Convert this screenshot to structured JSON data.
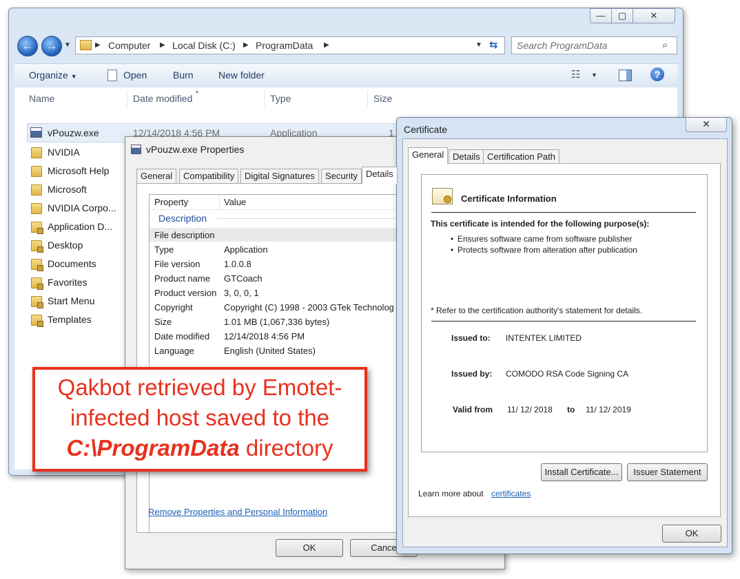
{
  "explorer": {
    "breadcrumb": [
      "Computer",
      "Local Disk (C:)",
      "ProgramData"
    ],
    "search_placeholder": "Search ProgramData",
    "toolbar": {
      "organize": "Organize",
      "open": "Open",
      "burn": "Burn",
      "new_folder": "New folder"
    },
    "columns": {
      "name": "Name",
      "date_modified": "Date modified",
      "type": "Type",
      "size": "Size"
    },
    "selected_file": {
      "name": "vPouzw.exe",
      "date_modified": "12/14/2018 4:56 PM",
      "type": "Application",
      "size": "1"
    },
    "items": [
      "NVIDIA",
      "Microsoft Help",
      "Microsoft",
      "NVIDIA Corpo...",
      "Application D...",
      "Desktop",
      "Documents",
      "Favorites",
      "Start Menu",
      "Templates"
    ]
  },
  "properties": {
    "title": "vPouzw.exe Properties",
    "tabs": [
      "General",
      "Compatibility",
      "Digital Signatures",
      "Security",
      "Details"
    ],
    "header": {
      "property": "Property",
      "value": "Value"
    },
    "section": "Description",
    "rows": [
      {
        "k": "File description",
        "v": ""
      },
      {
        "k": "Type",
        "v": "Application"
      },
      {
        "k": "File version",
        "v": "1.0.0.8"
      },
      {
        "k": "Product name",
        "v": "GTCoach"
      },
      {
        "k": "Product version",
        "v": "3, 0, 0, 1"
      },
      {
        "k": "Copyright",
        "v": "Copyright (C) 1998 - 2003 GTek Technolog"
      },
      {
        "k": "Size",
        "v": "1.01 MB (1,067,336 bytes)"
      },
      {
        "k": "Date modified",
        "v": "12/14/2018 4:56 PM"
      },
      {
        "k": "Language",
        "v": "English (United States)"
      }
    ],
    "remove_link": "Remove Properties and Personal Information",
    "ok": "OK",
    "cancel": "Cance"
  },
  "certificate": {
    "title": "Certificate",
    "tabs": [
      "General",
      "Details",
      "Certification Path"
    ],
    "info_title": "Certificate Information",
    "purpose_heading": "This certificate is intended for the following purpose(s):",
    "purposes": [
      "Ensures software came from software publisher",
      "Protects software from alteration after publication"
    ],
    "refer": "* Refer to the certification authority's statement for details.",
    "issued_to_label": "Issued to:",
    "issued_to": "INTENTEK LIMITED",
    "issued_by_label": "Issued by:",
    "issued_by": "COMODO RSA Code Signing CA",
    "valid_from_label": "Valid from",
    "valid_from": "11/ 12/ 2018",
    "to_label": "to",
    "valid_to": "11/ 12/ 2019",
    "install_button": "Install Certificate...",
    "issuer_button": "Issuer Statement",
    "learn_more": "Learn more about",
    "learn_link": "certificates",
    "ok": "OK"
  },
  "annotation": {
    "line1": "Qakbot retrieved by Emotet-",
    "line2": "infected host saved to the",
    "line3_bold": "C:\\ProgramData",
    "line3_rest": " directory"
  },
  "colors": {
    "annotation_red": "#e8311e",
    "link_blue": "#1a5fb4"
  }
}
